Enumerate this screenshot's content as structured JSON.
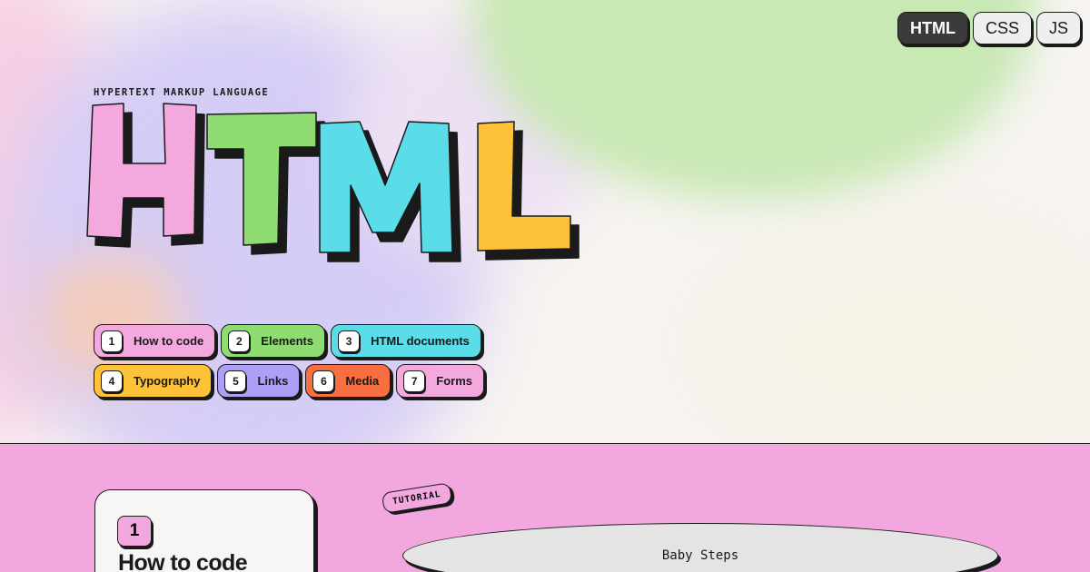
{
  "language_switcher": {
    "items": [
      {
        "label": "HTML",
        "active": true
      },
      {
        "label": "CSS",
        "active": false
      },
      {
        "label": "JS",
        "active": false
      }
    ]
  },
  "hero": {
    "kicker": "HYPERTEXT MARKUP LANGUAGE",
    "logo_text": "HTML",
    "logo_letters": [
      {
        "char": "H",
        "color": "#f4a9de"
      },
      {
        "char": "T",
        "color": "#8fdc73"
      },
      {
        "char": "M",
        "color": "#5bdde9"
      },
      {
        "char": "L",
        "color": "#fec238"
      }
    ]
  },
  "modules": [
    {
      "number": "1",
      "label": "How to code",
      "color": "#f4a9de"
    },
    {
      "number": "2",
      "label": "Elements",
      "color": "#8fdc73"
    },
    {
      "number": "3",
      "label": "HTML documents",
      "color": "#5bdde9"
    },
    {
      "number": "4",
      "label": "Typography",
      "color": "#fec238"
    },
    {
      "number": "5",
      "label": "Links",
      "color": "#ad9ff6"
    },
    {
      "number": "6",
      "label": "Media",
      "color": "#fa6f42"
    },
    {
      "number": "7",
      "label": "Forms",
      "color": "#f4a9de"
    }
  ],
  "section": {
    "card_number": "1",
    "card_title": "How to code",
    "tag": "TUTORIAL",
    "lesson_title": "Baby Steps"
  },
  "colors": {
    "band_background": "#f2a8de",
    "ink": "#1a1a1a"
  }
}
